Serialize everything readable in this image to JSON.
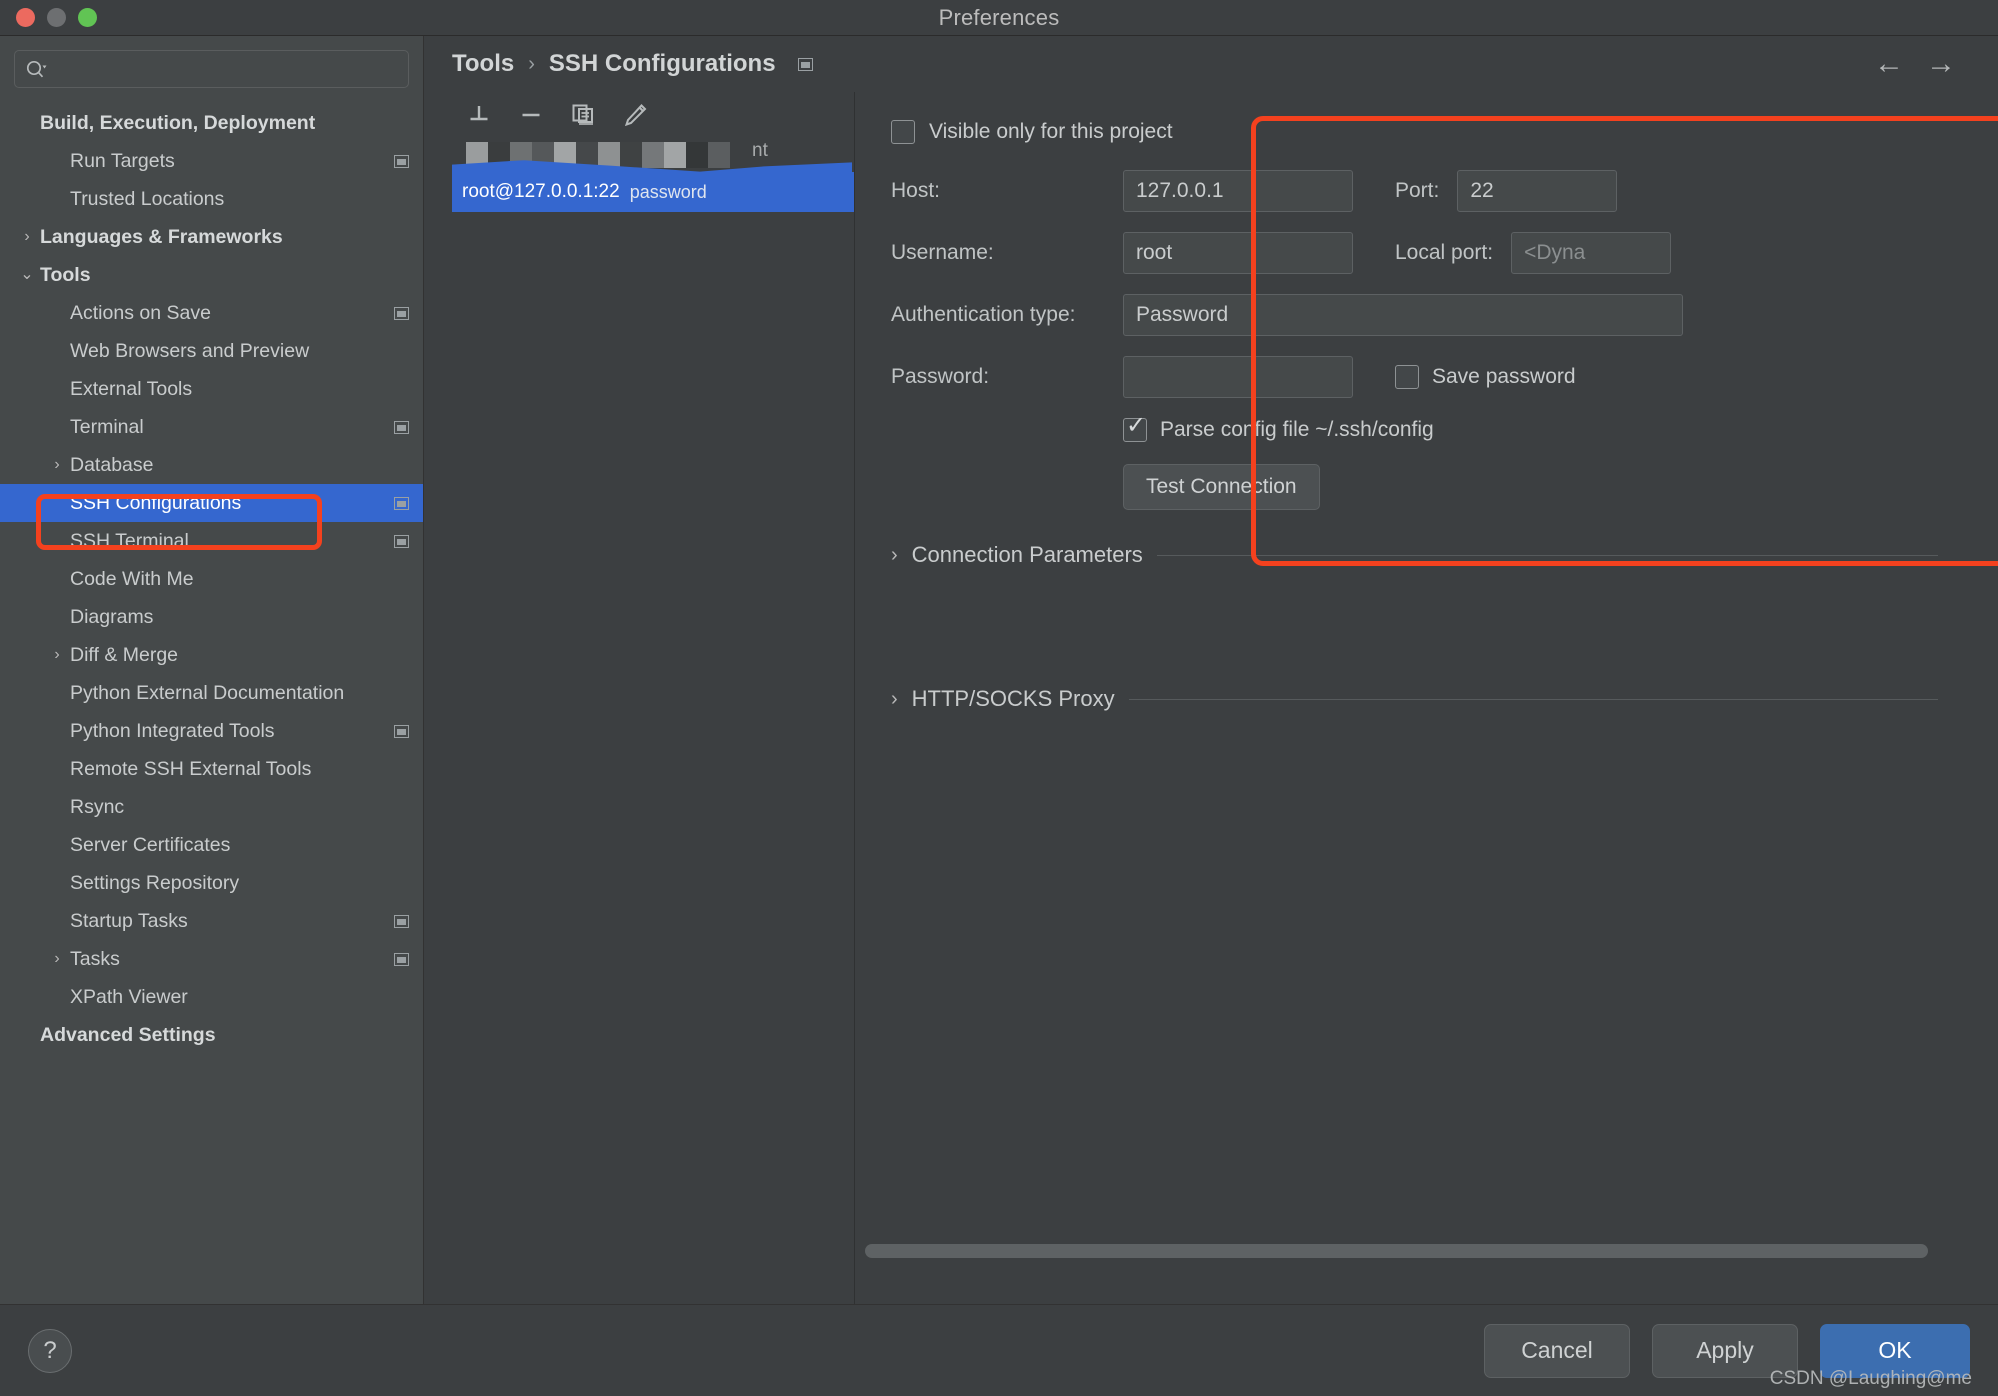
{
  "window": {
    "title": "Preferences",
    "traffic_lights": [
      "close",
      "minimize",
      "maximize"
    ]
  },
  "search": {
    "value": "",
    "placeholder": ""
  },
  "sidebar": {
    "items": [
      {
        "label": "Build, Execution, Deployment",
        "indent": 0,
        "group": true,
        "twisty": "",
        "config_icon": false,
        "selected": false
      },
      {
        "label": "Run Targets",
        "indent": 1,
        "group": false,
        "twisty": "",
        "config_icon": true,
        "selected": false
      },
      {
        "label": "Trusted Locations",
        "indent": 1,
        "group": false,
        "twisty": "",
        "config_icon": false,
        "selected": false
      },
      {
        "label": "Languages & Frameworks",
        "indent": 0,
        "group": true,
        "twisty": "›",
        "config_icon": false,
        "selected": false
      },
      {
        "label": "Tools",
        "indent": 0,
        "group": true,
        "twisty": "⌄",
        "config_icon": false,
        "selected": false
      },
      {
        "label": "Actions on Save",
        "indent": 1,
        "group": false,
        "twisty": "",
        "config_icon": true,
        "selected": false
      },
      {
        "label": "Web Browsers and Preview",
        "indent": 1,
        "group": false,
        "twisty": "",
        "config_icon": false,
        "selected": false
      },
      {
        "label": "External Tools",
        "indent": 1,
        "group": false,
        "twisty": "",
        "config_icon": false,
        "selected": false
      },
      {
        "label": "Terminal",
        "indent": 1,
        "group": false,
        "twisty": "",
        "config_icon": true,
        "selected": false
      },
      {
        "label": "Database",
        "indent": 2,
        "group": false,
        "twisty": "›",
        "config_icon": false,
        "selected": false
      },
      {
        "label": "SSH Configurations",
        "indent": 1,
        "group": false,
        "twisty": "",
        "config_icon": true,
        "selected": true
      },
      {
        "label": "SSH Terminal",
        "indent": 1,
        "group": false,
        "twisty": "",
        "config_icon": true,
        "selected": false
      },
      {
        "label": "Code With Me",
        "indent": 1,
        "group": false,
        "twisty": "",
        "config_icon": false,
        "selected": false
      },
      {
        "label": "Diagrams",
        "indent": 1,
        "group": false,
        "twisty": "",
        "config_icon": false,
        "selected": false
      },
      {
        "label": "Diff & Merge",
        "indent": 2,
        "group": false,
        "twisty": "›",
        "config_icon": false,
        "selected": false
      },
      {
        "label": "Python External Documentation",
        "indent": 1,
        "group": false,
        "twisty": "",
        "config_icon": false,
        "selected": false
      },
      {
        "label": "Python Integrated Tools",
        "indent": 1,
        "group": false,
        "twisty": "",
        "config_icon": true,
        "selected": false
      },
      {
        "label": "Remote SSH External Tools",
        "indent": 1,
        "group": false,
        "twisty": "",
        "config_icon": false,
        "selected": false
      },
      {
        "label": "Rsync",
        "indent": 1,
        "group": false,
        "twisty": "",
        "config_icon": false,
        "selected": false
      },
      {
        "label": "Server Certificates",
        "indent": 1,
        "group": false,
        "twisty": "",
        "config_icon": false,
        "selected": false
      },
      {
        "label": "Settings Repository",
        "indent": 1,
        "group": false,
        "twisty": "",
        "config_icon": false,
        "selected": false
      },
      {
        "label": "Startup Tasks",
        "indent": 1,
        "group": false,
        "twisty": "",
        "config_icon": true,
        "selected": false
      },
      {
        "label": "Tasks",
        "indent": 2,
        "group": false,
        "twisty": "›",
        "config_icon": true,
        "selected": false
      },
      {
        "label": "XPath Viewer",
        "indent": 1,
        "group": false,
        "twisty": "",
        "config_icon": false,
        "selected": false
      },
      {
        "label": "Advanced Settings",
        "indent": 0,
        "group": true,
        "twisty": "",
        "config_icon": false,
        "selected": false
      }
    ]
  },
  "breadcrumb": {
    "parent": "Tools",
    "separator": "›",
    "current": "SSH Configurations"
  },
  "nav": {
    "back": "←",
    "forward": "→"
  },
  "list_toolbar": {
    "add": "add-icon",
    "remove": "remove-icon",
    "copy": "copy-icon",
    "edit": "edit-icon"
  },
  "configurations": {
    "redacted_row_ghost_text": "nt",
    "rows": [
      {
        "name": "root@127.0.0.1:22",
        "auth": "password",
        "selected": true
      }
    ]
  },
  "detail": {
    "visible_only_label": "Visible only for this project",
    "visible_only_checked": false,
    "host_label": "Host:",
    "host_value": "127.0.0.1",
    "port_label": "Port:",
    "port_value": "22",
    "username_label": "Username:",
    "username_value": "root",
    "local_port_label": "Local port:",
    "local_port_placeholder": "<Dyna",
    "auth_type_label": "Authentication type:",
    "auth_type_value": "Password",
    "password_label": "Password:",
    "password_value": "",
    "save_password_label": "Save password",
    "save_password_checked": false,
    "parse_config_label": "Parse config file ~/.ssh/config",
    "parse_config_checked": true,
    "test_connection_label": "Test Connection",
    "connection_parameters_label": "Connection Parameters",
    "connection_parameters_twisty": "›",
    "proxy_label": "HTTP/SOCKS Proxy",
    "proxy_twisty": "›"
  },
  "footer": {
    "help": "?",
    "cancel": "Cancel",
    "apply": "Apply",
    "ok": "OK"
  },
  "watermark": "CSDN @Laughing@me",
  "colors": {
    "accent_selection": "#3567cf",
    "callout_red": "#f4411e",
    "primary_button": "#3c6eb0",
    "sidebar_bg": "#45494a",
    "panel_bg": "#3c3f41"
  }
}
